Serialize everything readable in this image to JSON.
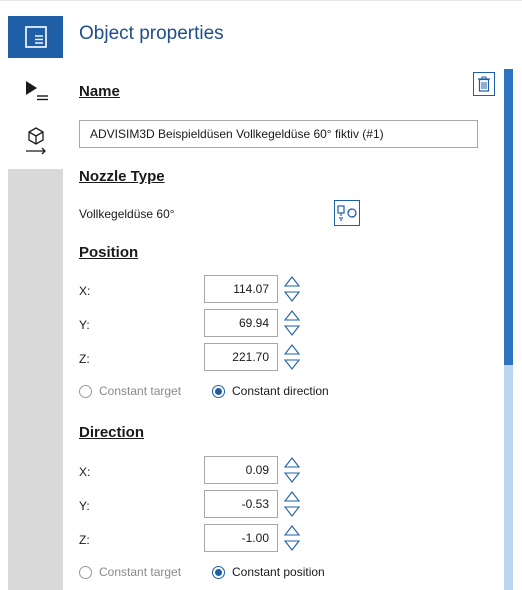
{
  "rail": {
    "items": [
      {
        "icon": "properties-panel-icon",
        "active": true
      },
      {
        "icon": "play-list-icon",
        "active": false
      },
      {
        "icon": "export-object-icon",
        "active": false
      }
    ]
  },
  "panel": {
    "title": "Object properties",
    "name": {
      "heading": "Name",
      "value": "ADVISIM3D Beispieldüsen Vollkegeldüse 60° fiktiv (#1)"
    },
    "nozzle": {
      "heading": "Nozzle Type",
      "value": "Vollkegeldüse 60°"
    },
    "position": {
      "heading": "Position",
      "x_label": "X:",
      "x_value": "114.07",
      "y_label": "Y:",
      "y_value": "69.94",
      "z_label": "Z:",
      "z_value": "221.70",
      "radio_target": "Constant target",
      "radio_direction": "Constant direction",
      "selected": "Constant direction"
    },
    "direction": {
      "heading": "Direction",
      "x_label": "X:",
      "x_value": "0.09",
      "y_label": "Y:",
      "y_value": "-0.53",
      "z_label": "Z:",
      "z_value": "-1.00",
      "radio_target": "Constant target",
      "radio_position": "Constant position",
      "selected": "Constant position"
    }
  },
  "colors": {
    "accent": "#1f5fa8",
    "title": "#1f4e8c",
    "scroll_track": "#bcd6f0",
    "scroll_thumb": "#2d74c0"
  }
}
